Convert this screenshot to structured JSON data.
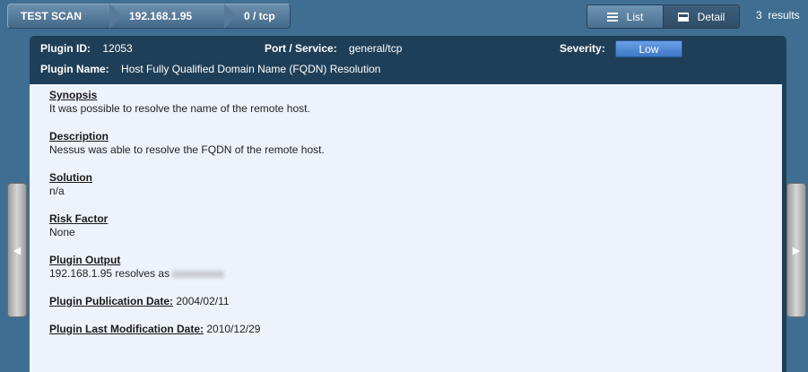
{
  "breadcrumb": [
    "TEST SCAN",
    "192.168.1.95",
    "0 / tcp"
  ],
  "view_toggle": {
    "list_label": "List",
    "detail_label": "Detail",
    "active": "Detail"
  },
  "results_count": "3  results",
  "plugin": {
    "id_label": "Plugin ID:",
    "id": "12053",
    "port_label": "Port / Service:",
    "port": "general/tcp",
    "severity_label": "Severity:",
    "severity": "Low",
    "severity_color": "#4a84d3",
    "name_label": "Plugin Name:",
    "name": "Host Fully Qualified Domain Name (FQDN) Resolution"
  },
  "sections": {
    "synopsis_title": "Synopsis",
    "synopsis_text": "It was possible to resolve the name of the remote host.",
    "description_title": "Description",
    "description_text": "Nessus was able to resolve the FQDN of the remote host.",
    "solution_title": "Solution",
    "solution_text": "n/a",
    "risk_title": "Risk Factor",
    "risk_text": "None",
    "output_title": "Plugin Output",
    "output_text": "192.168.1.95 resolves as",
    "pub_date_label": "Plugin Publication Date:",
    "pub_date": "2004/02/11",
    "mod_date_label": "Plugin Last Modification Date:",
    "mod_date": "2010/12/29"
  },
  "icons": {
    "prev": "chevron-left-icon",
    "next": "chevron-right-icon",
    "list": "list-icon",
    "detail": "detail-icon"
  }
}
